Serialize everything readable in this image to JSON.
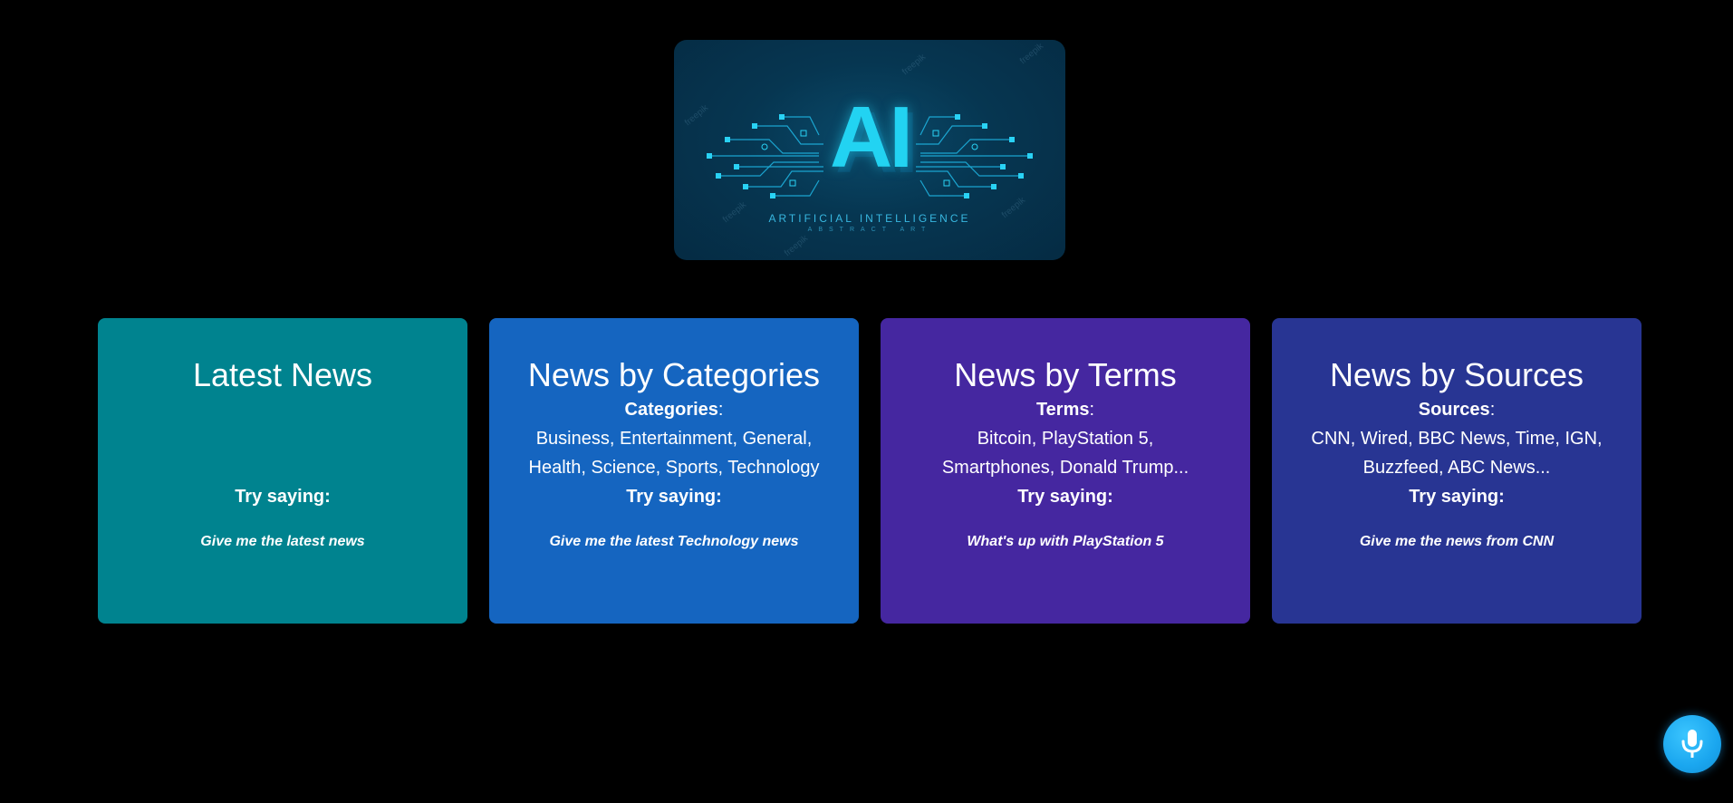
{
  "logo": {
    "word": "AI",
    "subtitle": "ARTIFICIAL INTELLIGENCE",
    "subtitle2": "ABSTRACT ART",
    "watermark": "freepik",
    "accent_color": "#22d3f2"
  },
  "cards": [
    {
      "title": "Latest News",
      "try_label": "Try saying:",
      "example": "Give me the latest news",
      "color": "#00838f"
    },
    {
      "title": "News by Categories",
      "label": "Categories",
      "list_line1": "Business, Entertainment, General,",
      "list_line2": "Health, Science, Sports, Technology",
      "try_label": "Try saying:",
      "example": "Give me the latest Technology news",
      "color": "#1565c0"
    },
    {
      "title": "News by Terms",
      "label": "Terms",
      "list_line1": "Bitcoin, PlayStation 5,",
      "list_line2": "Smartphones, Donald Trump...",
      "try_label": "Try saying:",
      "example": "What's up with PlayStation 5",
      "color": "#4527a0"
    },
    {
      "title": "News by Sources",
      "label": "Sources",
      "list_line1": "CNN, Wired, BBC News, Time, IGN,",
      "list_line2": "Buzzfeed, ABC News...",
      "try_label": "Try saying:",
      "example": "Give me the news from CNN",
      "color": "#283593"
    }
  ],
  "mic_button": {
    "icon": "microphone-icon",
    "color": "#1aa6ef"
  }
}
